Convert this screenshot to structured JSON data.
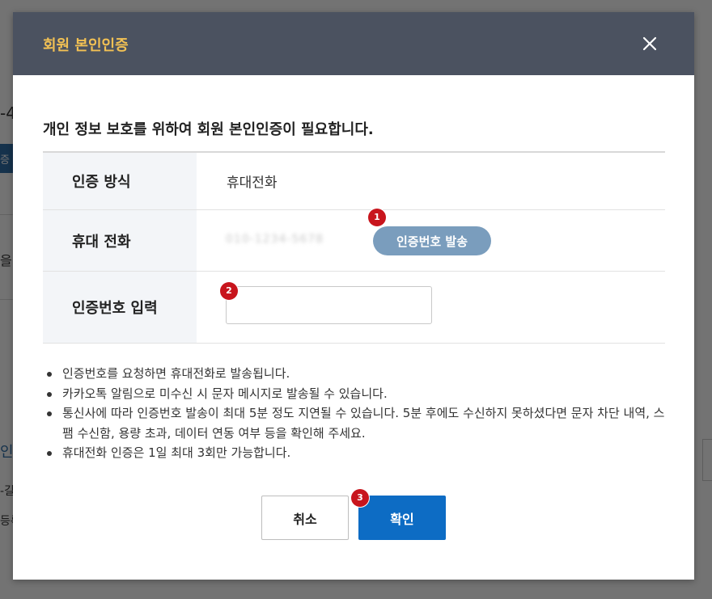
{
  "background": {
    "fragments": [
      "-4",
      "증",
      "을",
      "인",
      "-길",
      "등록"
    ]
  },
  "modal": {
    "title": "회원 본인인증",
    "close_label": "×",
    "intro": "개인 정보 보호를 위하여 회원 본인인증이 필요합니다.",
    "rows": [
      {
        "label": "인증 방식",
        "value": "휴대전화"
      },
      {
        "label": "휴대 전화",
        "masked_value": "010-1234-5678",
        "send_button": "인증번호 발송"
      },
      {
        "label": "인증번호 입력",
        "input_value": "",
        "input_placeholder": ""
      }
    ],
    "badges": [
      "1",
      "2",
      "3"
    ],
    "notes": [
      "인증번호를 요청하면 휴대전화로 발송됩니다.",
      "카카오톡 알림으로 미수신 시 문자 메시지로 발송될 수 있습니다.",
      "통신사에 따라 인증번호 발송이 최대 5분 정도 지연될 수 있습니다. 5분 후에도 수신하지 못하셨다면 문자 차단 내역, 스팸 수신함, 용량 초과, 데이터 연동 여부 등을 확인해 주세요.",
      "휴대전화 인증은 1일 최대 3회만 가능합니다."
    ],
    "cancel_button": "취소",
    "confirm_button": "확인"
  },
  "colors": {
    "header_bg": "#4b5260",
    "title": "#f2c154",
    "send_button": "#7a9dbd",
    "confirm_button": "#0d6cc4",
    "badge": "#c8151d"
  }
}
